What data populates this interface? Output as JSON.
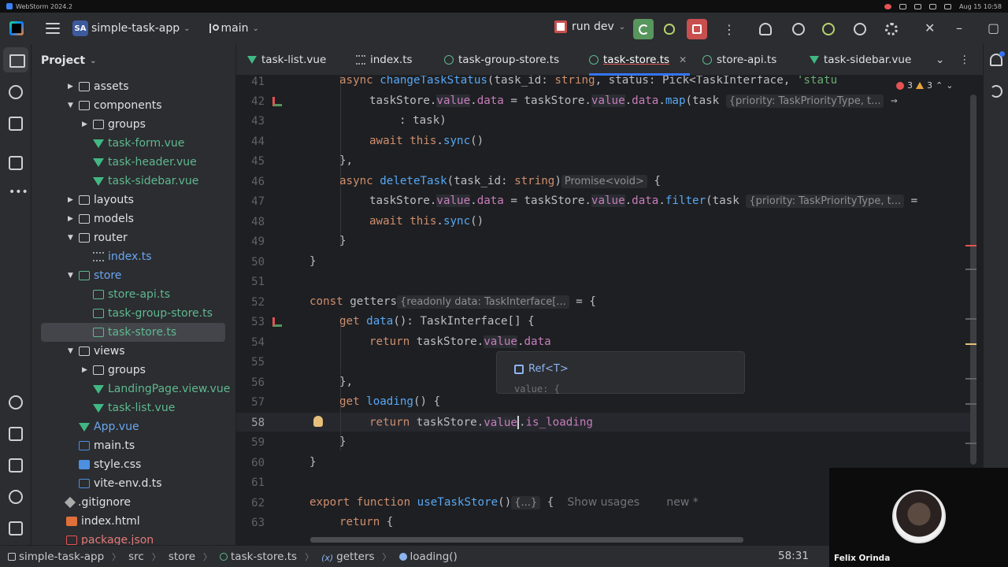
{
  "os": {
    "app_name": "WebStorm 2024.2",
    "date_time": "Aug 15  10:58"
  },
  "titlebar": {
    "project_badge": "SA",
    "project_name": "simple-task-app",
    "branch": "main",
    "run_config": "run dev"
  },
  "project_panel": {
    "title": "Project",
    "items": [
      {
        "label": "assets"
      },
      {
        "label": "components"
      },
      {
        "label": "groups"
      },
      {
        "label": "task-form.vue"
      },
      {
        "label": "task-header.vue"
      },
      {
        "label": "task-sidebar.vue"
      },
      {
        "label": "layouts"
      },
      {
        "label": "models"
      },
      {
        "label": "router"
      },
      {
        "label": "index.ts"
      },
      {
        "label": "store"
      },
      {
        "label": "store-api.ts"
      },
      {
        "label": "task-group-store.ts"
      },
      {
        "label": "task-store.ts"
      },
      {
        "label": "views"
      },
      {
        "label": "groups"
      },
      {
        "label": "LandingPage.view.vue"
      },
      {
        "label": "task-list.vue"
      },
      {
        "label": "App.vue"
      },
      {
        "label": "main.ts"
      },
      {
        "label": "style.css"
      },
      {
        "label": "vite-env.d.ts"
      },
      {
        "label": ".gitignore"
      },
      {
        "label": "index.html"
      },
      {
        "label": "package.json"
      }
    ]
  },
  "tabs": [
    {
      "label": "task-list.vue"
    },
    {
      "label": "index.ts"
    },
    {
      "label": "task-group-store.ts"
    },
    {
      "label": "task-store.ts"
    },
    {
      "label": "store-api.ts"
    },
    {
      "label": "task-sidebar.vue"
    }
  ],
  "editor": {
    "line_numbers": [
      "41",
      "42",
      "43",
      "44",
      "45",
      "46",
      "47",
      "48",
      "49",
      "50",
      "51",
      "52",
      "53",
      "54",
      "55",
      "56",
      "57",
      "58",
      "59",
      "60",
      "61",
      "62",
      "63"
    ],
    "inspections": {
      "errors": "3",
      "warnings": "3"
    },
    "hints": {
      "line42": "{priority: TaskPriorityType, t...",
      "line46": "Promise<void>",
      "line47": "{priority: TaskPriorityType, t...",
      "line52": "{readonly data: TaskInterface[...",
      "line62": "{...}",
      "usages": "Show usages",
      "new_label": "new *"
    },
    "completion": {
      "item": "Ref<T>",
      "sub": "value: {"
    }
  },
  "statusbar": {
    "crumbs": [
      "simple-task-app",
      "src",
      "store",
      "task-store.ts",
      "getters",
      "loading()"
    ],
    "cursor": "58:31"
  },
  "webcam": {
    "name": "Felix Orinda"
  }
}
